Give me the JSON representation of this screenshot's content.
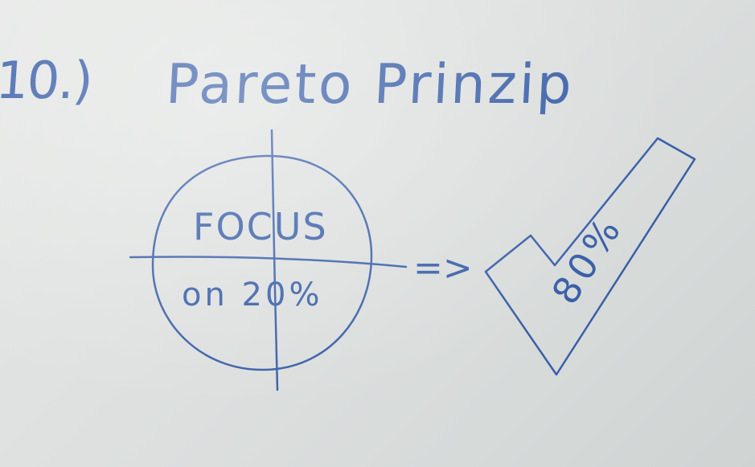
{
  "board": {
    "title_number": "10.)",
    "title_text": "Pareto Prinzip",
    "circle_top_text": "FOCUS",
    "circle_bottom_text": "on 20%",
    "arrow_text": "=>",
    "check_text": "80%"
  },
  "colors": {
    "ink": "#3a5fa8",
    "board": "#dfe2e1"
  },
  "icons": {
    "target_circle": "crosshair-circle-icon",
    "arrow": "implies-arrow-icon",
    "check": "checkmark-icon"
  }
}
